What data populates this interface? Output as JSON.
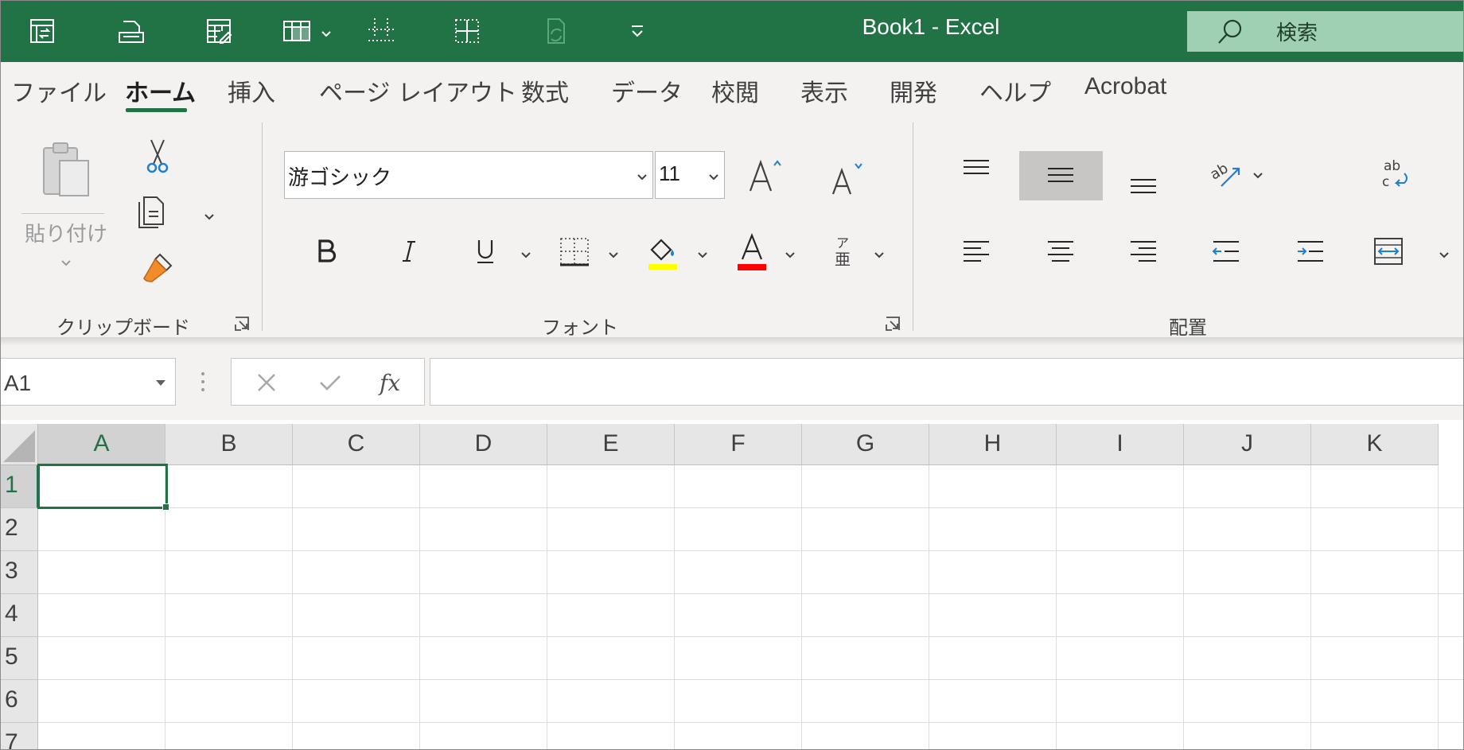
{
  "window": {
    "title": "Book1  -  Excel"
  },
  "search": {
    "label": "検索"
  },
  "tabs": [
    {
      "label": "ファイル"
    },
    {
      "label": "ホーム"
    },
    {
      "label": "挿入"
    },
    {
      "label": "ページ レイアウト"
    },
    {
      "label": "数式"
    },
    {
      "label": "データ"
    },
    {
      "label": "校閲"
    },
    {
      "label": "表示"
    },
    {
      "label": "開発"
    },
    {
      "label": "ヘルプ"
    },
    {
      "label": "Acrobat"
    }
  ],
  "ribbon": {
    "clipboard": {
      "paste_label": "貼り付け",
      "group_label": "クリップボード"
    },
    "font": {
      "name": "游ゴシック",
      "size": "11",
      "group_label": "フォント",
      "phonetic_top": "ア",
      "phonetic_bottom": "亜"
    },
    "alignment": {
      "group_label": "配置"
    }
  },
  "formula_bar": {
    "name_box": "A1",
    "formula": ""
  },
  "grid": {
    "columns": [
      "A",
      "B",
      "C",
      "D",
      "E",
      "F",
      "G",
      "H",
      "I",
      "J",
      "K"
    ],
    "rows": [
      "1",
      "2",
      "3",
      "4",
      "5",
      "6",
      "7"
    ],
    "active_cell": "A1"
  },
  "colors": {
    "excel_green": "#217346",
    "highlight_yellow": "#ffff00",
    "font_red": "#ff0000",
    "accent_blue": "#1f7fd0"
  }
}
